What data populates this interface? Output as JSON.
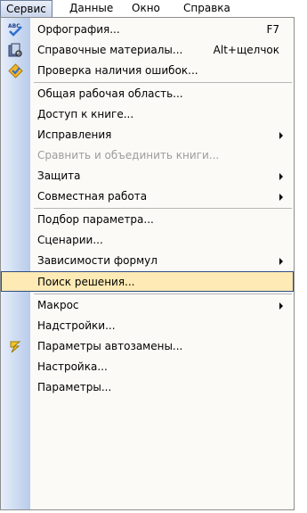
{
  "menubar": {
    "items": [
      {
        "label": "Сервис",
        "active": true
      },
      {
        "label": "Данные"
      },
      {
        "label": "Окно"
      },
      {
        "label": "Справка"
      }
    ]
  },
  "menu": {
    "items": [
      {
        "id": "spelling",
        "label": "Орфография...",
        "shortcut": "F7",
        "icon": "spelling-check-icon"
      },
      {
        "id": "research",
        "label": "Справочные материалы...",
        "shortcut": "Alt+щелчок",
        "icon": "research-icon"
      },
      {
        "id": "error-check",
        "label": "Проверка наличия ошибок...",
        "icon": "error-check-icon"
      },
      {
        "id": "shared-workspace",
        "label": "Общая рабочая область..."
      },
      {
        "id": "share-workbook",
        "label": "Доступ к книге..."
      },
      {
        "id": "track-changes",
        "label": "Исправления",
        "submenu": true
      },
      {
        "id": "compare-merge",
        "label": "Сравнить и объединить книги...",
        "disabled": true
      },
      {
        "id": "protection",
        "label": "Защита",
        "submenu": true
      },
      {
        "id": "online-collab",
        "label": "Совместная работа",
        "submenu": true
      },
      {
        "id": "goal-seek",
        "label": "Подбор параметра..."
      },
      {
        "id": "scenarios",
        "label": "Сценарии..."
      },
      {
        "id": "formula-auditing",
        "label": "Зависимости формул",
        "submenu": true
      },
      {
        "id": "solver",
        "label": "Поиск решения...",
        "highlighted": true
      },
      {
        "id": "macro",
        "label": "Макрос",
        "submenu": true
      },
      {
        "id": "addins",
        "label": "Надстройки..."
      },
      {
        "id": "autocorrect",
        "label": "Параметры автозамены...",
        "icon": "autocorrect-icon"
      },
      {
        "id": "customize",
        "label": "Настройка..."
      },
      {
        "id": "options",
        "label": "Параметры..."
      }
    ]
  },
  "colors": {
    "highlight_bg": "#fdeab4",
    "highlight_border": "#2f4e86",
    "disabled_text": "#9d9d9d",
    "strip_light": "#e6eefb",
    "strip_dark": "#b8cbe9"
  }
}
